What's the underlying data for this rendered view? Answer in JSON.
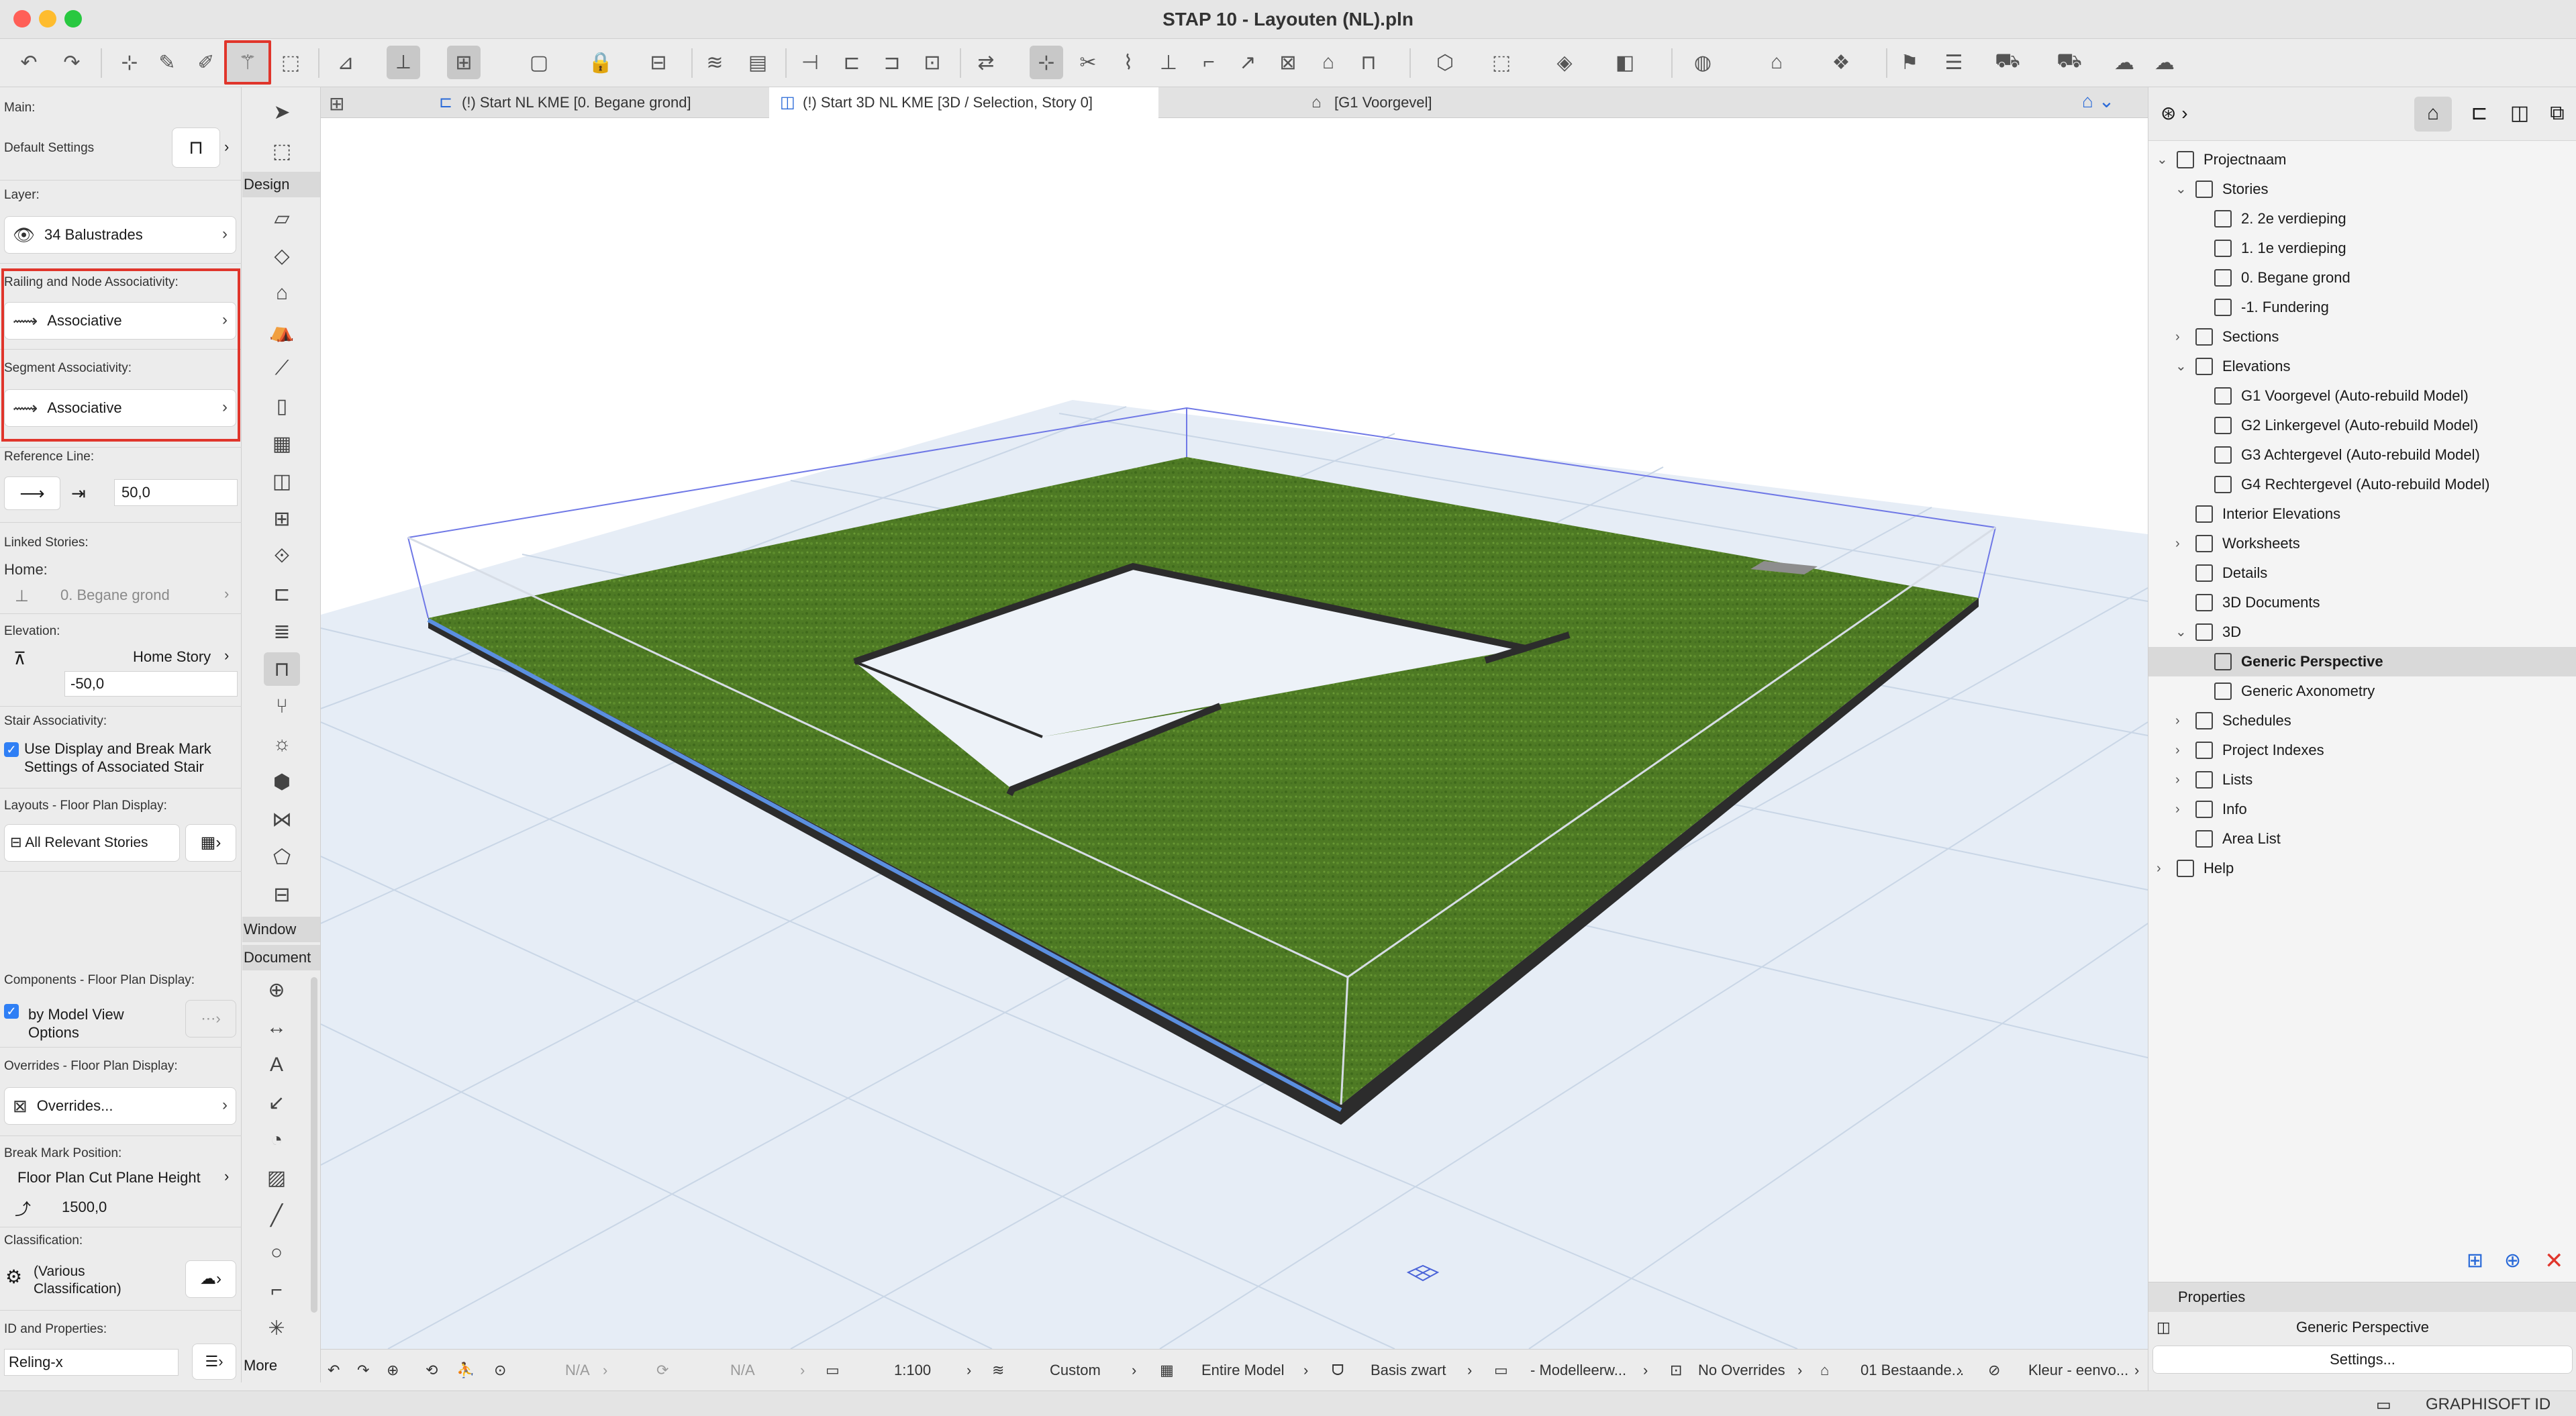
{
  "window": {
    "title": "STAP 10 - Layouten (NL).pln",
    "brand": "GRAPHISOFT ID"
  },
  "info_box": {
    "main_label": "Main:",
    "default_settings_label": "Default Settings",
    "layer_label": "Layer:",
    "layer_value": "34 Balustrades",
    "railing_assoc_label": "Railing and Node Associativity:",
    "railing_assoc_value": "Associative",
    "segment_assoc_label": "Segment Associativity:",
    "segment_assoc_value": "Associative",
    "reference_line_label": "Reference Line:",
    "reference_line_value": "50,0",
    "linked_stories_label": "Linked Stories:",
    "home_label": "Home:",
    "home_value": "0. Begane grond",
    "elevation_label": "Elevation:",
    "elevation_mode": "Home Story",
    "elevation_value": "-50,0",
    "stair_assoc_label": "Stair Associativity:",
    "stair_assoc_checkbox": "Use Display and Break Mark Settings of Associated Stair",
    "layouts_label": "Layouts - Floor Plan Display:",
    "layouts_value": "All Relevant Stories",
    "components_label": "Components - Floor Plan Display:",
    "components_checkbox": "by Model View Options",
    "overrides_label": "Overrides - Floor Plan Display:",
    "overrides_value": "Overrides...",
    "break_mark_label": "Break Mark Position:",
    "break_mark_mode": "Floor Plan Cut Plane Height",
    "break_mark_value": "1500,0",
    "classification_label": "Classification:",
    "classification_value": "(Various Classification)",
    "id_label": "ID and Properties:",
    "id_value": "Reling-x"
  },
  "toolbox": {
    "design_label": "Design",
    "window_label": "Window",
    "document_label": "Document",
    "more_label": "More"
  },
  "tabs": [
    {
      "label": "(!) Start NL KME [0. Begane grond]"
    },
    {
      "label": "(!) Start 3D NL KME [3D / Selection, Story 0]"
    },
    {
      "label": "[G1 Voorgevel]"
    }
  ],
  "status_bar": {
    "na1": "N/A",
    "na2": "N/A",
    "scale": "1:100",
    "custom": "Custom",
    "entire_model": "Entire Model",
    "pen_set": "Basis zwart",
    "model_view": "- Modelleerw...",
    "overrides": "No Overrides",
    "renovation": "01 Bestaande...",
    "color": "Kleur - eenvo..."
  },
  "navigator": {
    "items": [
      {
        "label": "Projectnaam",
        "level": 0,
        "arrow": "open"
      },
      {
        "label": "Stories",
        "level": 1,
        "arrow": "open"
      },
      {
        "label": "2. 2e verdieping",
        "level": 2,
        "arrow": "none"
      },
      {
        "label": "1. 1e verdieping",
        "level": 2,
        "arrow": "none"
      },
      {
        "label": "0. Begane grond",
        "level": 2,
        "arrow": "none"
      },
      {
        "label": "-1. Fundering",
        "level": 2,
        "arrow": "none"
      },
      {
        "label": "Sections",
        "level": 1,
        "arrow": "closed"
      },
      {
        "label": "Elevations",
        "level": 1,
        "arrow": "open"
      },
      {
        "label": "G1 Voorgevel (Auto-rebuild Model)",
        "level": 2,
        "arrow": "none"
      },
      {
        "label": "G2 Linkergevel (Auto-rebuild Model)",
        "level": 2,
        "arrow": "none"
      },
      {
        "label": "G3 Achtergevel (Auto-rebuild Model)",
        "level": 2,
        "arrow": "none"
      },
      {
        "label": "G4 Rechtergevel (Auto-rebuild Model)",
        "level": 2,
        "arrow": "none"
      },
      {
        "label": "Interior Elevations",
        "level": 1,
        "arrow": "none"
      },
      {
        "label": "Worksheets",
        "level": 1,
        "arrow": "closed"
      },
      {
        "label": "Details",
        "level": 1,
        "arrow": "none"
      },
      {
        "label": "3D Documents",
        "level": 1,
        "arrow": "none"
      },
      {
        "label": "3D",
        "level": 1,
        "arrow": "open"
      },
      {
        "label": "Generic Perspective",
        "level": 2,
        "arrow": "none",
        "selected": true
      },
      {
        "label": "Generic Axonometry",
        "level": 2,
        "arrow": "none"
      },
      {
        "label": "Schedules",
        "level": 1,
        "arrow": "closed"
      },
      {
        "label": "Project Indexes",
        "level": 1,
        "arrow": "closed"
      },
      {
        "label": "Lists",
        "level": 1,
        "arrow": "closed"
      },
      {
        "label": "Info",
        "level": 1,
        "arrow": "closed"
      },
      {
        "label": "Area List",
        "level": 1,
        "arrow": "none"
      },
      {
        "label": "Help",
        "level": 0,
        "arrow": "closed"
      }
    ],
    "properties_label": "Properties",
    "properties_value": "Generic Perspective",
    "settings_button": "Settings..."
  },
  "colors": {
    "highlight_red": "#e0352b",
    "grass": "#4e7a24",
    "selection_blue": "#5b8fe0"
  }
}
